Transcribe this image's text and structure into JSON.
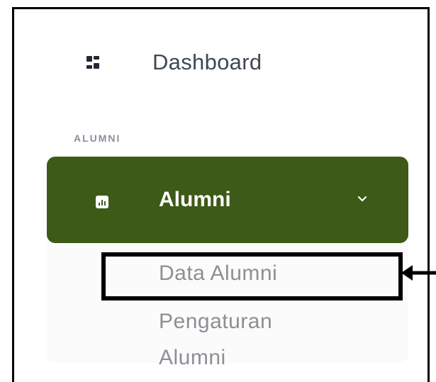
{
  "sidebar": {
    "dashboard": {
      "label": "Dashboard",
      "icon": "dashboard-grid-icon"
    },
    "section_title": "ALUMNI",
    "alumni_menu": {
      "label": "Alumni",
      "icon": "chart-icon",
      "expand_icon": "chevron-down-icon",
      "active_color": "#3d5a17",
      "submenu": [
        {
          "label": "Data Alumni",
          "highlighted": true
        },
        {
          "label": "Pengaturan Alumni",
          "line1": "Pengaturan",
          "line2": "Alumni"
        }
      ]
    }
  },
  "annotation": {
    "type": "highlight-box-with-arrow",
    "target": "Data Alumni",
    "color": "#000000"
  }
}
